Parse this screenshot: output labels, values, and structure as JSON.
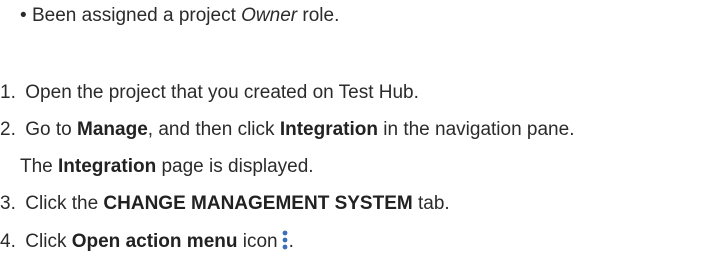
{
  "prereq": {
    "bullet": "•",
    "text_before": "Been assigned a project ",
    "role": "Owner",
    "text_after": " role."
  },
  "steps": [
    {
      "number": "1.",
      "text": "Open the project that you created on Test Hub."
    },
    {
      "number": "2.",
      "pre": "Go to ",
      "manage": "Manage",
      "mid": ", and then click ",
      "integration": "Integration",
      "post": " in the navigation pane.",
      "result_pre": "The ",
      "result_bold": "Integration",
      "result_post": " page is displayed."
    },
    {
      "number": "3.",
      "pre": "Click the ",
      "bold": "CHANGE MANAGEMENT SYSTEM",
      "post": " tab."
    },
    {
      "number": "4.",
      "pre": "Click ",
      "bold": "Open action menu",
      "post": " icon",
      "end": ".",
      "icon": "more-vertical-icon",
      "icon_color": "#3d6fb6"
    }
  ]
}
